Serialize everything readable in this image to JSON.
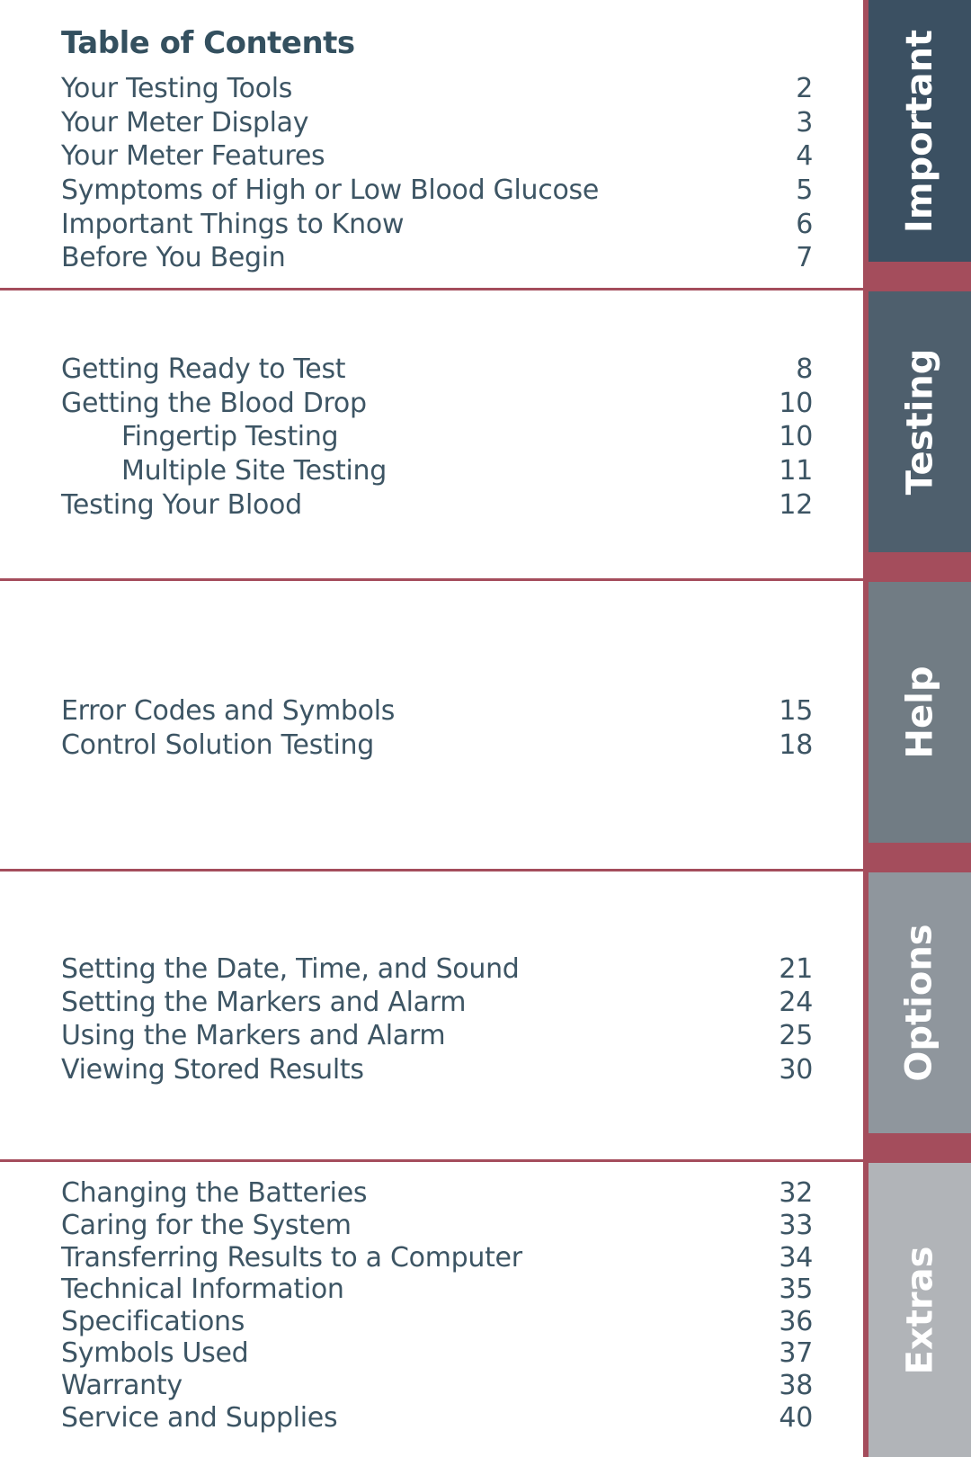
{
  "title": "Table of Contents",
  "sections": [
    {
      "tab": "Important",
      "tab_color": "#3b5062",
      "entries": [
        {
          "label": "Your Testing Tools",
          "page": "2",
          "indent": false
        },
        {
          "label": "Your Meter Display",
          "page": "3",
          "indent": false
        },
        {
          "label": "Your Meter Features",
          "page": "4",
          "indent": false
        },
        {
          "label": "Symptoms of High or Low Blood Glucose",
          "page": "5",
          "indent": false
        },
        {
          "label": "Important Things to Know",
          "page": "6",
          "indent": false
        },
        {
          "label": "Before You Begin",
          "page": "7",
          "indent": false
        }
      ]
    },
    {
      "tab": "Testing",
      "tab_color": "#4e5f6d",
      "entries": [
        {
          "label": "Getting Ready to Test",
          "page": "8",
          "indent": false
        },
        {
          "label": "Getting the Blood Drop",
          "page": "10",
          "indent": false
        },
        {
          "label": "Fingertip Testing",
          "page": "10",
          "indent": true
        },
        {
          "label": "Multiple Site Testing",
          "page": "11",
          "indent": true
        },
        {
          "label": "Testing Your Blood",
          "page": "12",
          "indent": false
        }
      ]
    },
    {
      "tab": "Help",
      "tab_color": "#717c84",
      "entries": [
        {
          "label": "Error Codes and Symbols",
          "page": "15",
          "indent": false
        },
        {
          "label": "Control Solution Testing",
          "page": "18",
          "indent": false
        }
      ]
    },
    {
      "tab": "Options",
      "tab_color": "#8f969d",
      "entries": [
        {
          "label": "Setting the Date, Time, and Sound",
          "page": "21",
          "indent": false
        },
        {
          "label": "Setting the Markers and Alarm",
          "page": "24",
          "indent": false
        },
        {
          "label": "Using the Markers and Alarm",
          "page": "25",
          "indent": false
        },
        {
          "label": "Viewing Stored Results",
          "page": "30",
          "indent": false
        }
      ]
    },
    {
      "tab": "Extras",
      "tab_color": "#b1b4b8",
      "entries": [
        {
          "label": "Changing the Batteries",
          "page": "32",
          "indent": false
        },
        {
          "label": "Caring for the System",
          "page": "33",
          "indent": false
        },
        {
          "label": "Transferring Results to a Computer",
          "page": "34",
          "indent": false
        },
        {
          "label": "Technical Information",
          "page": "35",
          "indent": false
        },
        {
          "label": "Specifications",
          "page": "36",
          "indent": false
        },
        {
          "label": "Symbols Used",
          "page": "37",
          "indent": false
        },
        {
          "label": "Warranty",
          "page": "38",
          "indent": false
        },
        {
          "label": "Service and Supplies",
          "page": "40",
          "indent": false
        }
      ]
    }
  ],
  "accent_color": "#a44d5c"
}
